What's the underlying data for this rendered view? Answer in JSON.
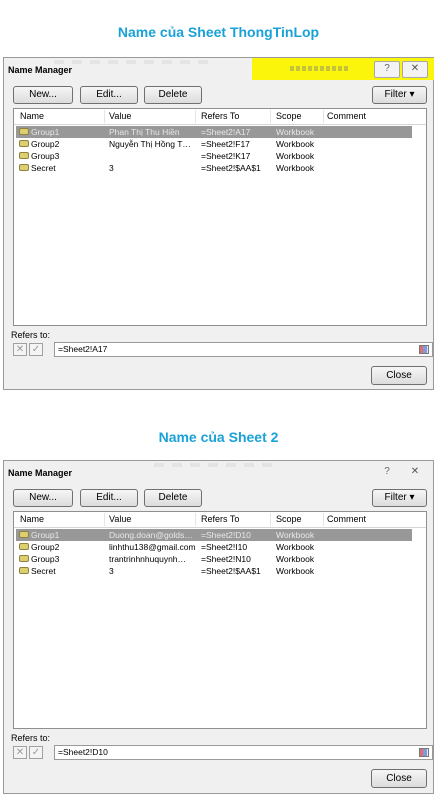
{
  "heading1": "Name của Sheet ThongTinLop",
  "heading2": "Name của Sheet 2",
  "dialog": {
    "title": "Name Manager",
    "help": "?",
    "close_x": "✕",
    "new_label": "New...",
    "edit_label": "Edit...",
    "delete_label": "Delete",
    "filter_label": "Filter ▾",
    "refers_to_label": "Refers to:",
    "close_label": "Close",
    "columns": [
      "Name",
      "Value",
      "Refers To",
      "Scope",
      "Comment"
    ]
  },
  "panel1": {
    "rows": [
      {
        "name": "Group1",
        "value": "Phan Thị Thu Hiền",
        "refers": "=Sheet2!A17",
        "scope": "Workbook"
      },
      {
        "name": "Group2",
        "value": "Nguyễn Thị Hồng T…",
        "refers": "=Sheet2!F17",
        "scope": "Workbook"
      },
      {
        "name": "Group3",
        "value": "",
        "refers": "=Sheet2!K17",
        "scope": "Workbook"
      },
      {
        "name": "Secret",
        "value": "3",
        "refers": "=Sheet2!$AA$1",
        "scope": "Workbook"
      }
    ],
    "refers_value": "=Sheet2!A17"
  },
  "panel2": {
    "rows": [
      {
        "name": "Group1",
        "value": "Duong.doan@golds…",
        "refers": "=Sheet2!D10",
        "scope": "Workbook"
      },
      {
        "name": "Group2",
        "value": "linhthu138@gmail.com",
        "refers": "=Sheet2!I10",
        "scope": "Workbook"
      },
      {
        "name": "Group3",
        "value": "trantrinhnhuquynh…",
        "refers": "=Sheet2!N10",
        "scope": "Workbook"
      },
      {
        "name": "Secret",
        "value": "3",
        "refers": "=Sheet2!$AA$1",
        "scope": "Workbook"
      }
    ],
    "refers_value": "=Sheet2!D10"
  }
}
